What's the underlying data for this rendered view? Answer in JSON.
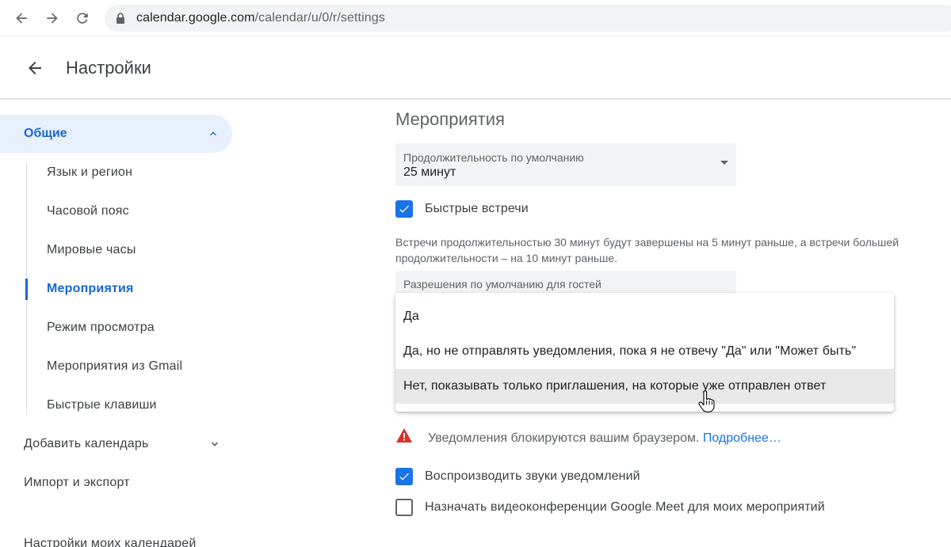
{
  "browser": {
    "url_host": "calendar.google.com",
    "url_path": "/calendar/u/0/r/settings"
  },
  "header": {
    "title": "Настройки"
  },
  "sidebar": {
    "general_label": "Общие",
    "sub_items": [
      "Язык и регион",
      "Часовой пояс",
      "Мировые часы",
      "Мероприятия",
      "Режим просмотра",
      "Мероприятия из Gmail",
      "Быстрые клавиши"
    ],
    "active_sub_item": "Мероприятия",
    "add_calendar": "Добавить календарь",
    "import_export": "Импорт и экспорт",
    "my_calendars": "Настройки моих календарей"
  },
  "main": {
    "section_title": "Мероприятия",
    "duration": {
      "label": "Продолжительность по умолчанию",
      "value": "25 минут"
    },
    "speedy_meetings": {
      "label": "Быстрые встречи",
      "checked": true
    },
    "speedy_description": "Встречи продолжительностью 30 минут будут завершены на 5 минут раньше, а встречи большей продолжительности – на 10 минут раньше.",
    "guest_permissions": {
      "label": "Разрешения по умолчанию для гостей"
    },
    "dropdown_options": [
      "Да",
      "Да, но не отправлять уведомления, пока я не отвечу \"Да\" или \"Может быть\"",
      "Нет, показывать только приглашения, на которые уже отправлен ответ"
    ],
    "hovered_option_index": 2,
    "notification_warning": "Уведомления блокируются вашим браузером.",
    "notification_link": "Подробнее…",
    "play_sounds": {
      "label": "Воспроизводить звуки уведомлений",
      "checked": true
    },
    "google_meet": {
      "label": "Назначать видеоконференции Google Meet для моих мероприятий",
      "checked": false
    }
  },
  "colors": {
    "accent": "#1a73e8",
    "active_text": "#1967d2",
    "active_bg": "#e8f0fe",
    "warning": "#d93025"
  }
}
